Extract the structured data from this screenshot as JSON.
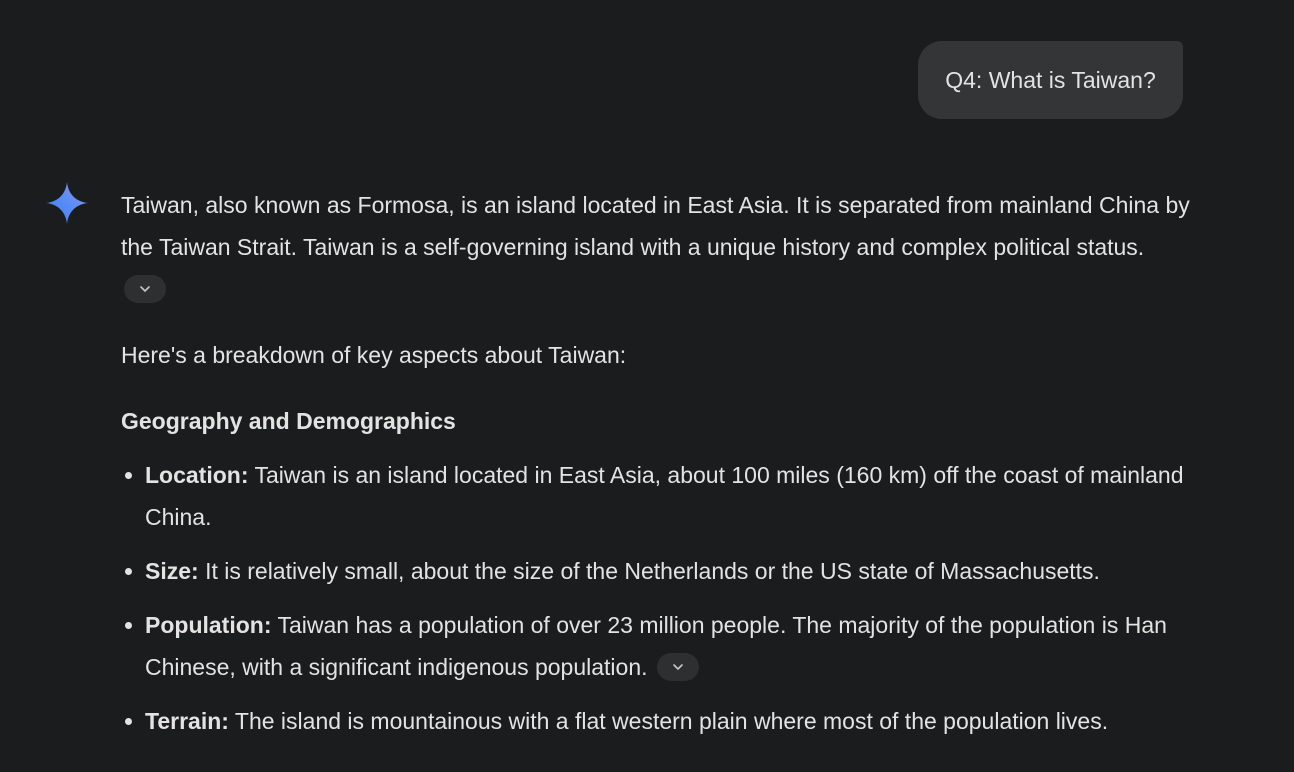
{
  "user_message": {
    "text": "Q4: What is Taiwan?"
  },
  "assistant": {
    "icon": "gemini-sparkle-icon",
    "intro": "Taiwan, also known as Formosa, is an island located in East Asia. It is separated from mainland China by the Taiwan Strait. Taiwan is a self-governing island with a unique history and complex political status.",
    "breakdown": "Here's a breakdown of key aspects about Taiwan:",
    "section_heading": "Geography and Demographics",
    "items": [
      {
        "label": "Location:",
        "text": " Taiwan is an island located in East Asia, about 100 miles (160 km) off the coast of mainland China."
      },
      {
        "label": "Size:",
        "text": " It is relatively small, about the size of the Netherlands or the US state of Massachusetts."
      },
      {
        "label": "Population:",
        "text": " Taiwan has a population of over 23 million people. The majority of the population is Han Chinese, with a significant indigenous population."
      },
      {
        "label": "Terrain:",
        "text": " The island is mountainous with a flat western plain where most of the population lives."
      }
    ]
  },
  "colors": {
    "background": "#1b1c1d",
    "bubble": "#333537",
    "text": "#e3e3e3",
    "chip": "#2d2f31"
  }
}
